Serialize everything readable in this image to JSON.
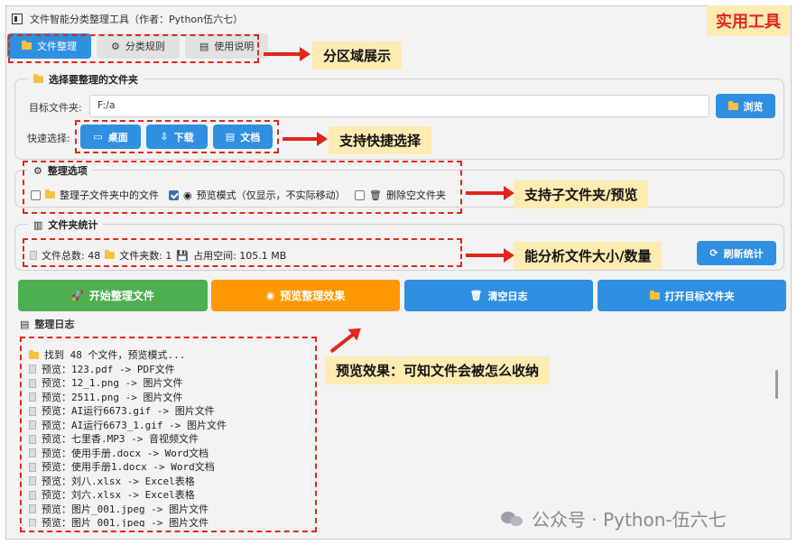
{
  "window": {
    "title": "文件智能分类整理工具（作者：Python伍六七）"
  },
  "badge": "实用工具",
  "tabs": [
    {
      "label": "文件整理",
      "icon": "folder-icon",
      "active": true
    },
    {
      "label": "分类规则",
      "icon": "gear-icon",
      "active": false
    },
    {
      "label": "使用说明",
      "icon": "book-icon",
      "active": false
    }
  ],
  "callouts": {
    "tabs": "分区域展示",
    "quick": "支持快捷选择",
    "options": "支持子文件夹/预览",
    "stats": "能分析文件大小/数量",
    "log": "预览效果：可知文件会被怎么收纳"
  },
  "folder_select": {
    "title": "选择要整理的文件夹",
    "target_label": "目标文件夹:",
    "target_value": "F:/a",
    "browse_label": "浏览",
    "quick_label": "快速选择:",
    "quick_buttons": [
      "桌面",
      "下载",
      "文档"
    ]
  },
  "options": {
    "title": "整理选项",
    "items": [
      {
        "label": "整理子文件夹中的文件",
        "checked": false
      },
      {
        "label": "预览模式（仅显示，不实际移动）",
        "checked": true
      },
      {
        "label": "删除空文件夹",
        "checked": false
      }
    ]
  },
  "stats": {
    "title": "文件夹统计",
    "text": "文件总数: 48",
    "folders": "文件夹数: 1",
    "size": "占用空间: 105.1 MB",
    "refresh_label": "刷新统计"
  },
  "actions": {
    "start": "开始整理文件",
    "preview": "预览整理效果",
    "clear": "清空日志",
    "open": "打开目标文件夹"
  },
  "log": {
    "title": "整理日志",
    "lines": [
      "找到 48 个文件，预览模式...",
      "预览：123.pdf -> PDF文件",
      "预览：12_1.png -> 图片文件",
      "预览：2511.png -> 图片文件",
      "预览：AI运行6673.gif -> 图片文件",
      "预览：AI运行6673_1.gif -> 图片文件",
      "预览：七里香.MP3 -> 音视频文件",
      "预览：使用手册.docx -> Word文档",
      "预览：使用手册1.docx -> Word文档",
      "预览：刘八.xlsx -> Excel表格",
      "预览：刘六.xlsx -> Excel表格",
      "预览：图片_001.jpeg -> 图片文件",
      "预览：图片_001.jpeg -> 图片文件"
    ]
  },
  "watermark": "公众号 · Python-伍六七",
  "colors": {
    "accent": "#2f8fe0",
    "green": "#4caf50",
    "orange": "#ff9800",
    "annotation": "#e3261c",
    "callout_bg": "#fdebb1"
  }
}
